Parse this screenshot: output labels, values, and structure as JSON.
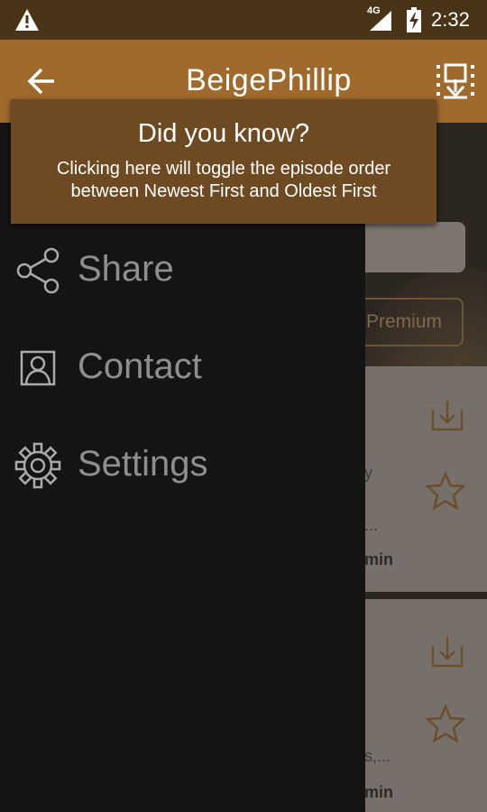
{
  "status_bar": {
    "network": "4G",
    "time": "2:32",
    "icons": [
      "warning-icon",
      "signal-icon",
      "battery-charging-icon"
    ]
  },
  "toolbar": {
    "title": "BeigePhillip",
    "icons": [
      "back-arrow-icon",
      "order-toggle-icon"
    ]
  },
  "tooltip": {
    "title": "Did you know?",
    "body": "Clicking here will toggle the episode order between Newest First and Oldest First"
  },
  "drawer": {
    "items": [
      {
        "label": "Share",
        "icon": "share-icon"
      },
      {
        "label": "Contact",
        "icon": "contact-icon"
      },
      {
        "label": "Settings",
        "icon": "settings-icon"
      }
    ]
  },
  "background": {
    "premium_label": "Premium",
    "cards": [
      {
        "fragment_1": "y",
        "fragment_2": "...",
        "duration_fragment": "min"
      },
      {
        "fragment_1": "s,...",
        "duration_fragment": "min"
      }
    ]
  },
  "colors": {
    "status_bar": "#4a3417",
    "toolbar": "#a06a2c",
    "tooltip": "#6e4a23",
    "drawer": "#141414"
  }
}
